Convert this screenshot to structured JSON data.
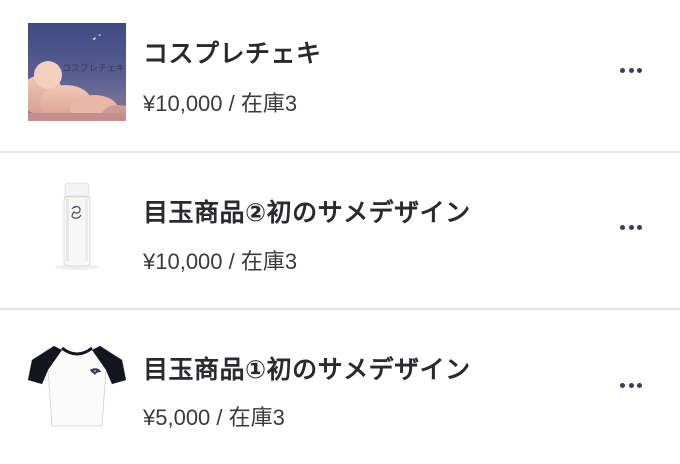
{
  "products": [
    {
      "title": "コスプレチェキ",
      "price": "¥10,000 / 在庫3",
      "thumbnail": "cosplay-cheki-photo",
      "thumb_text": "コスプレチェキ"
    },
    {
      "title": "目玉商品②初のサメデザイン",
      "price": "¥10,000 / 在庫3",
      "thumbnail": "white-water-bottle-photo"
    },
    {
      "title": "目玉商品①初のサメデザイン",
      "price": "¥5,000 / 在庫3",
      "thumbnail": "raglan-tshirt-photo"
    }
  ],
  "more_icon": "more-horizontal-icon",
  "colors": {
    "title": "#2a2a2e",
    "price": "#3a3a3e",
    "divider": "#e4e6ea",
    "icon": "#3a3f55"
  }
}
